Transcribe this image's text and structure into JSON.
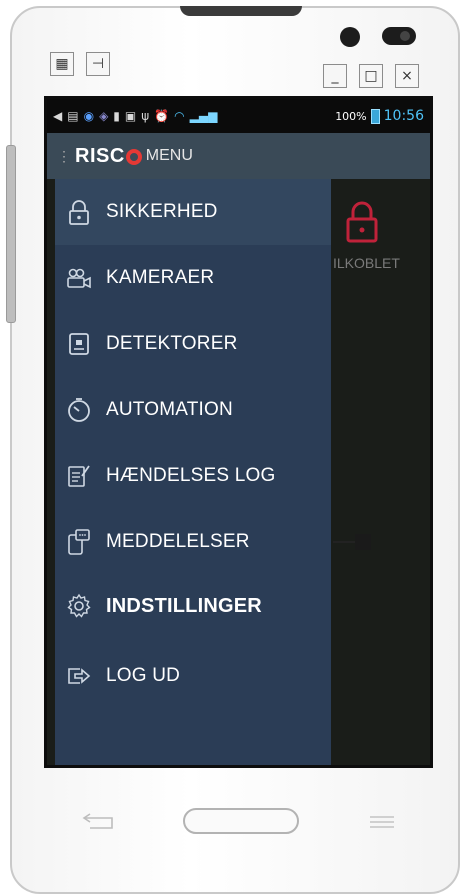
{
  "window": {
    "controls": {
      "minimize": "_",
      "maximize": "□",
      "close": "×"
    },
    "top_left_buttons": [
      "grid-icon",
      "plug-icon"
    ]
  },
  "statusbar": {
    "battery_percent": "100%",
    "time": "10:56",
    "icons": [
      "back-arrow-icon",
      "notes-icon",
      "counter-icon",
      "app-icon",
      "sd-icon",
      "screen-icon",
      "usb-icon",
      "alarm-icon",
      "wifi-icon",
      "signal-icon",
      "battery-icon"
    ]
  },
  "appbar": {
    "logo": "RISC",
    "title": "MENU"
  },
  "background": {
    "status_text": "ILKOBLET",
    "lock_color": "#c0223a"
  },
  "drawer": {
    "items": [
      {
        "label": "SIKKERHED",
        "icon": "lock-icon"
      },
      {
        "label": "KAMERAER",
        "icon": "camera-icon"
      },
      {
        "label": "DETEKTORER",
        "icon": "detector-icon"
      },
      {
        "label": "AUTOMATION",
        "icon": "timer-icon"
      },
      {
        "label": "HÆNDELSES LOG",
        "icon": "event-log-icon"
      },
      {
        "label": "MEDDELELSER",
        "icon": "messages-icon"
      },
      {
        "label": "INDSTILLINGER",
        "icon": "gear-icon"
      },
      {
        "label": "LOG UD",
        "icon": "logout-icon"
      }
    ]
  },
  "colors": {
    "drawer_bg": "#2b3d56",
    "appbar_bg": "#3a4a57",
    "logo_accent": "#e53935",
    "clock": "#4fc3f7"
  }
}
